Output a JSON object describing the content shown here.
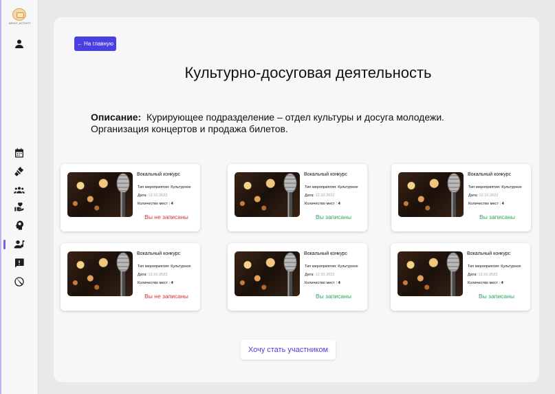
{
  "logo": {
    "text": "ABOUT_ACTIVITY"
  },
  "sidebar": {
    "items": [
      {
        "icon": "calendar-icon"
      },
      {
        "icon": "badminton-icon"
      },
      {
        "icon": "group-icon"
      },
      {
        "icon": "volunteer-icon"
      },
      {
        "icon": "psychology-icon"
      },
      {
        "icon": "person-music-icon",
        "active": true
      },
      {
        "icon": "feedback-icon"
      },
      {
        "icon": "block-icon"
      }
    ],
    "accent_color": "#6c63e6"
  },
  "header": {
    "back_label": "На главную",
    "back_arrow": "←",
    "title": "Культурно-досуговая деятельность"
  },
  "description": {
    "label": "Описание:",
    "text": "Курирующее подразделение – отдел культуры и досуга молодежи. Организация концертов и продажа билетов."
  },
  "events": [
    {
      "title": "Вокальный конкурс",
      "type_label": "Тип мероприятия:",
      "type": "Культурное",
      "date_label": "Дата:",
      "date": "12.10.2022",
      "seats_label": "Количество мест :",
      "seats": "4",
      "status": "Вы не записаны",
      "registered": false
    },
    {
      "title": "Вокальный конкурс",
      "type_label": "Тип мероприятия:",
      "type": "Культурное",
      "date_label": "Дата:",
      "date": "12.10.2022",
      "seats_label": "Количество мест :",
      "seats": "4",
      "status": "Вы записаны",
      "registered": true
    },
    {
      "title": "Вокальный конкурс",
      "type_label": "Тип мероприятия:",
      "type": "Культурное",
      "date_label": "Дата:",
      "date": "12.10.2022",
      "seats_label": "Количество мест :",
      "seats": "4",
      "status": "Вы записаны",
      "registered": true
    },
    {
      "title": "Вокальный конкурс",
      "type_label": "Тип мероприятия:",
      "type": "Культурное",
      "date_label": "Дата:",
      "date": "12.10.2022",
      "seats_label": "Количество мест :",
      "seats": "4",
      "status": "Вы не записаны",
      "registered": false
    },
    {
      "title": "Вокальный конкурс",
      "type_label": "Тип мероприятия:",
      "type": "Культурное",
      "date_label": "Дата:",
      "date": "12.10.2022",
      "seats_label": "Количество мест :",
      "seats": "4",
      "status": "Вы записаны",
      "registered": true
    },
    {
      "title": "Вокальный конкурс",
      "type_label": "Тип мероприятия:",
      "type": "Культурное",
      "date_label": "Дата:",
      "date": "12.10.2022",
      "seats_label": "Количество мест :",
      "seats": "4",
      "status": "Вы записаны",
      "registered": true
    }
  ],
  "footer": {
    "join_label": "Хочу стать участником"
  },
  "colors": {
    "primary": "#4a3fe0",
    "registered": "#2aa65c",
    "not_registered": "#d8322f"
  }
}
